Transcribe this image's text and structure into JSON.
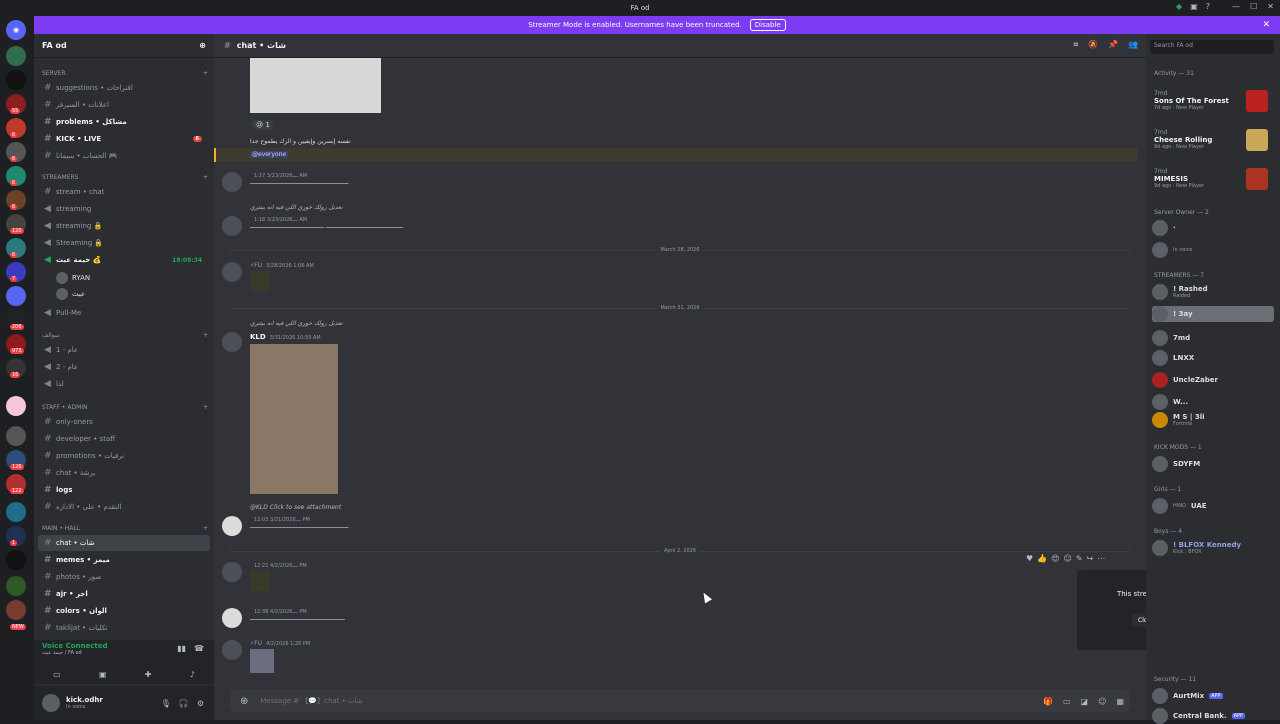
{
  "window": {
    "title": "FA od"
  },
  "banner": {
    "text": "Streamer Mode is enabled. Usernames have been truncated.",
    "button": "Disable"
  },
  "guild_badges": [
    "55",
    "6",
    "6",
    "6",
    "6",
    "120",
    "6",
    "7",
    "206",
    "973",
    "16",
    "126",
    "122",
    "1"
  ],
  "new_badge": "NEW",
  "server": {
    "name": "FA od"
  },
  "categories": {
    "server": "SERVER",
    "streamers": "STREAMERS",
    "voice": "سوالف",
    "staff": "STAFF • ADMIN",
    "main": "MAIN • HALL"
  },
  "channels": {
    "c1": "suggestions • اقتراحات",
    "c2": "اعلانات • السيرفر",
    "c3": "problems • مشاكل",
    "c4": "KICK • LIVE",
    "c5": "الحساب • سيمانا 🎮",
    "c6": "stream • chat",
    "c7": "streaming",
    "c8": "streaming 🔒",
    "c9": "Streaming 🔒",
    "c10": "خيمة عيث 💰",
    "c11": "Pull-Me",
    "c12": "عام - 1",
    "c13": "عام - 2",
    "c14": "لذا",
    "c15": "only-oners",
    "c16": "developer • staff",
    "c17": "promotions • ترقيات",
    "c18": "chat • برشة",
    "c19": "logs",
    "c20": "التقدم • على • الاداره",
    "c21": "chat • شات",
    "c22": "memes • ميمز",
    "c23": "photos • صور",
    "c24": "ajr • اجر",
    "c25": "colors • الوان",
    "c26": "taklijat • تكليات"
  },
  "badges": {
    "c4": "6"
  },
  "voice": {
    "timer": "18:08:34",
    "u1": "RYAN",
    "u2": "عيث"
  },
  "voice_connected": {
    "title": "Voice Connected",
    "sub": "خيمة عيث / FA od"
  },
  "user": {
    "name": "kick.odhr",
    "status": "In voice"
  },
  "header": {
    "channel": "chat • شات"
  },
  "messages": {
    "reaction": "1",
    "m0": "نفسه إبسرين وإيفيين و الرك يطموح جدا",
    "mention": "@everyone",
    "m1_time": "3/23/2026 1:17 AM",
    "m1_text": "ــــــــــــــــــــــــــــــــــــــــــــــــــــــــ",
    "m2_reply": "تعديل رولك خوري اللي فيه انه بيتتري",
    "m2_time": "3/23/2026 1:18 AM",
    "m2_text": "ــــــــــــــــــــــــــــــــــــــــــــ ــــــــــــــــــــــــــــــــــــــــــ",
    "d1": "March 28, 2026",
    "m3_time": "3/28/2026 1:06 AM",
    "m3_tag": "⚡FU",
    "d2": "March 31, 2026",
    "m4_reply": "تعديل رولك خوري اللي فيه انه بيتتري",
    "m4_name": "KLD",
    "m4_time": "3/31/2026 10:59 AM",
    "m5_reply": "@KLD Click to see attachment",
    "m5_time": "3/31/2026 12:03 PM",
    "m5_text": "ــــــــــــــــــــــــــــــــــــــــــــــــــــــــ",
    "d3": "April 2, 2026",
    "m6_time": "4/2/2026 12:21 PM",
    "m7_time": "4/2/2026 12:38 PM",
    "m7_text": "ــــــــــــــــــــــــــــــــــــــــــــــــــــــ",
    "m8_time": "4/2/2026 1:20 PM",
    "m8_tag": "⚡FU"
  },
  "composer": {
    "placeholder": "Message # 【💬】chat • شات"
  },
  "toast": {
    "text": "This stream has ended.",
    "button": "Close Stream"
  },
  "members": {
    "search": "Search FA od",
    "activity": "Activity — 31",
    "a1": {
      "by": "7md",
      "game": "Sons Of The Forest",
      "meta": "7d ago · New Player"
    },
    "a2": {
      "by": "7md",
      "game": "Cheese Rolling",
      "meta": "9d ago · New Player"
    },
    "a3": {
      "by": "7md",
      "game": "MIMESIS",
      "meta": "9d ago · New Player"
    },
    "owner": "Server Owner — 2",
    "owner_sub": "In voice",
    "streamers": "STREAMERS — 7",
    "s1": "! Rashed",
    "s1_sub": "Raided",
    "s2": "! 3ay",
    "s3": "7md",
    "s4": "LNXX",
    "s5": "UncleZaber",
    "s6": "W...",
    "s7": "M S | 3li",
    "s7_sub": "Fortnite",
    "kickmods": "KICK MODS — 1",
    "k1": "SDYFM",
    "girls": "Girls — 1",
    "g1": "HINO",
    "g1_tag": "UAE",
    "boys": "Boys — 4",
    "b1": "! BLFOX Kennedy",
    "b1_sub": "Kick : BFOX",
    "security": "Security — 11",
    "sec1": "AurtMix",
    "sec2": "Central Bank.",
    "app": "APP"
  }
}
